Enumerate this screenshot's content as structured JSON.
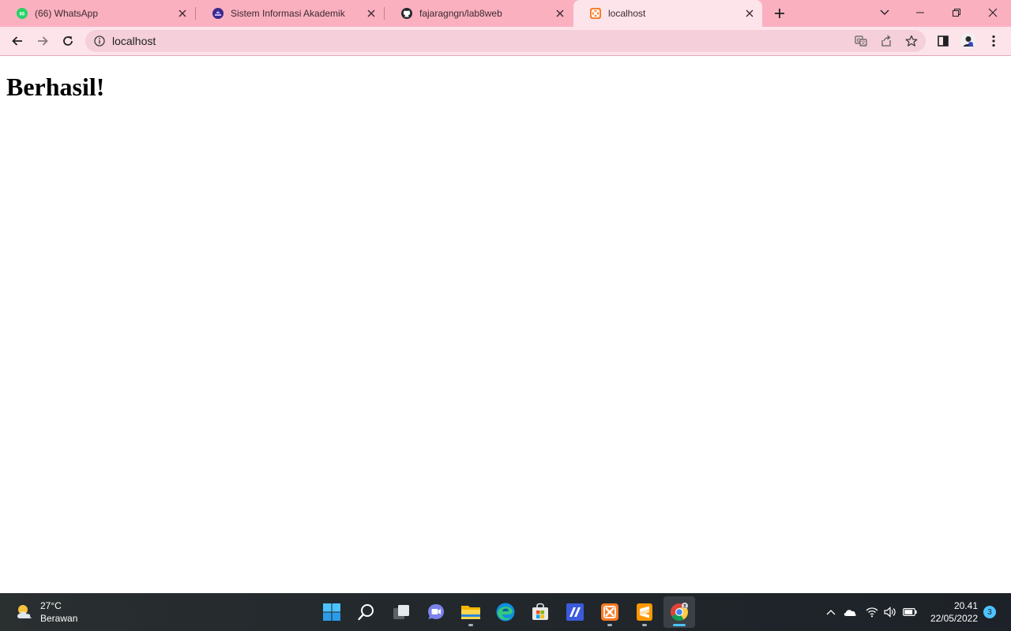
{
  "browser": {
    "tabs": [
      {
        "title": "(66) WhatsApp",
        "favicon": "whatsapp-icon",
        "active": false
      },
      {
        "title": "Sistem Informasi Akademik",
        "favicon": "university-icon",
        "active": false
      },
      {
        "title": "fajaragngn/lab8web",
        "favicon": "github-icon",
        "active": false
      },
      {
        "title": "localhost",
        "favicon": "xampp-icon",
        "active": true
      }
    ],
    "address_bar": {
      "url": "localhost"
    },
    "accent_color": "#fbb0c0"
  },
  "page": {
    "heading": "Berhasil!"
  },
  "taskbar": {
    "weather": {
      "temperature": "27°C",
      "condition": "Berawan"
    },
    "apps": [
      "windows-start-icon",
      "search-icon",
      "task-view-icon",
      "teams-chat-icon",
      "file-explorer-icon",
      "edge-icon",
      "microsoft-store-icon",
      "visual-studio-code-icon",
      "xampp-icon",
      "sublime-text-icon",
      "chrome-icon"
    ],
    "clock": {
      "time": "20.41",
      "date": "22/05/2022"
    },
    "notification_count": "3"
  }
}
